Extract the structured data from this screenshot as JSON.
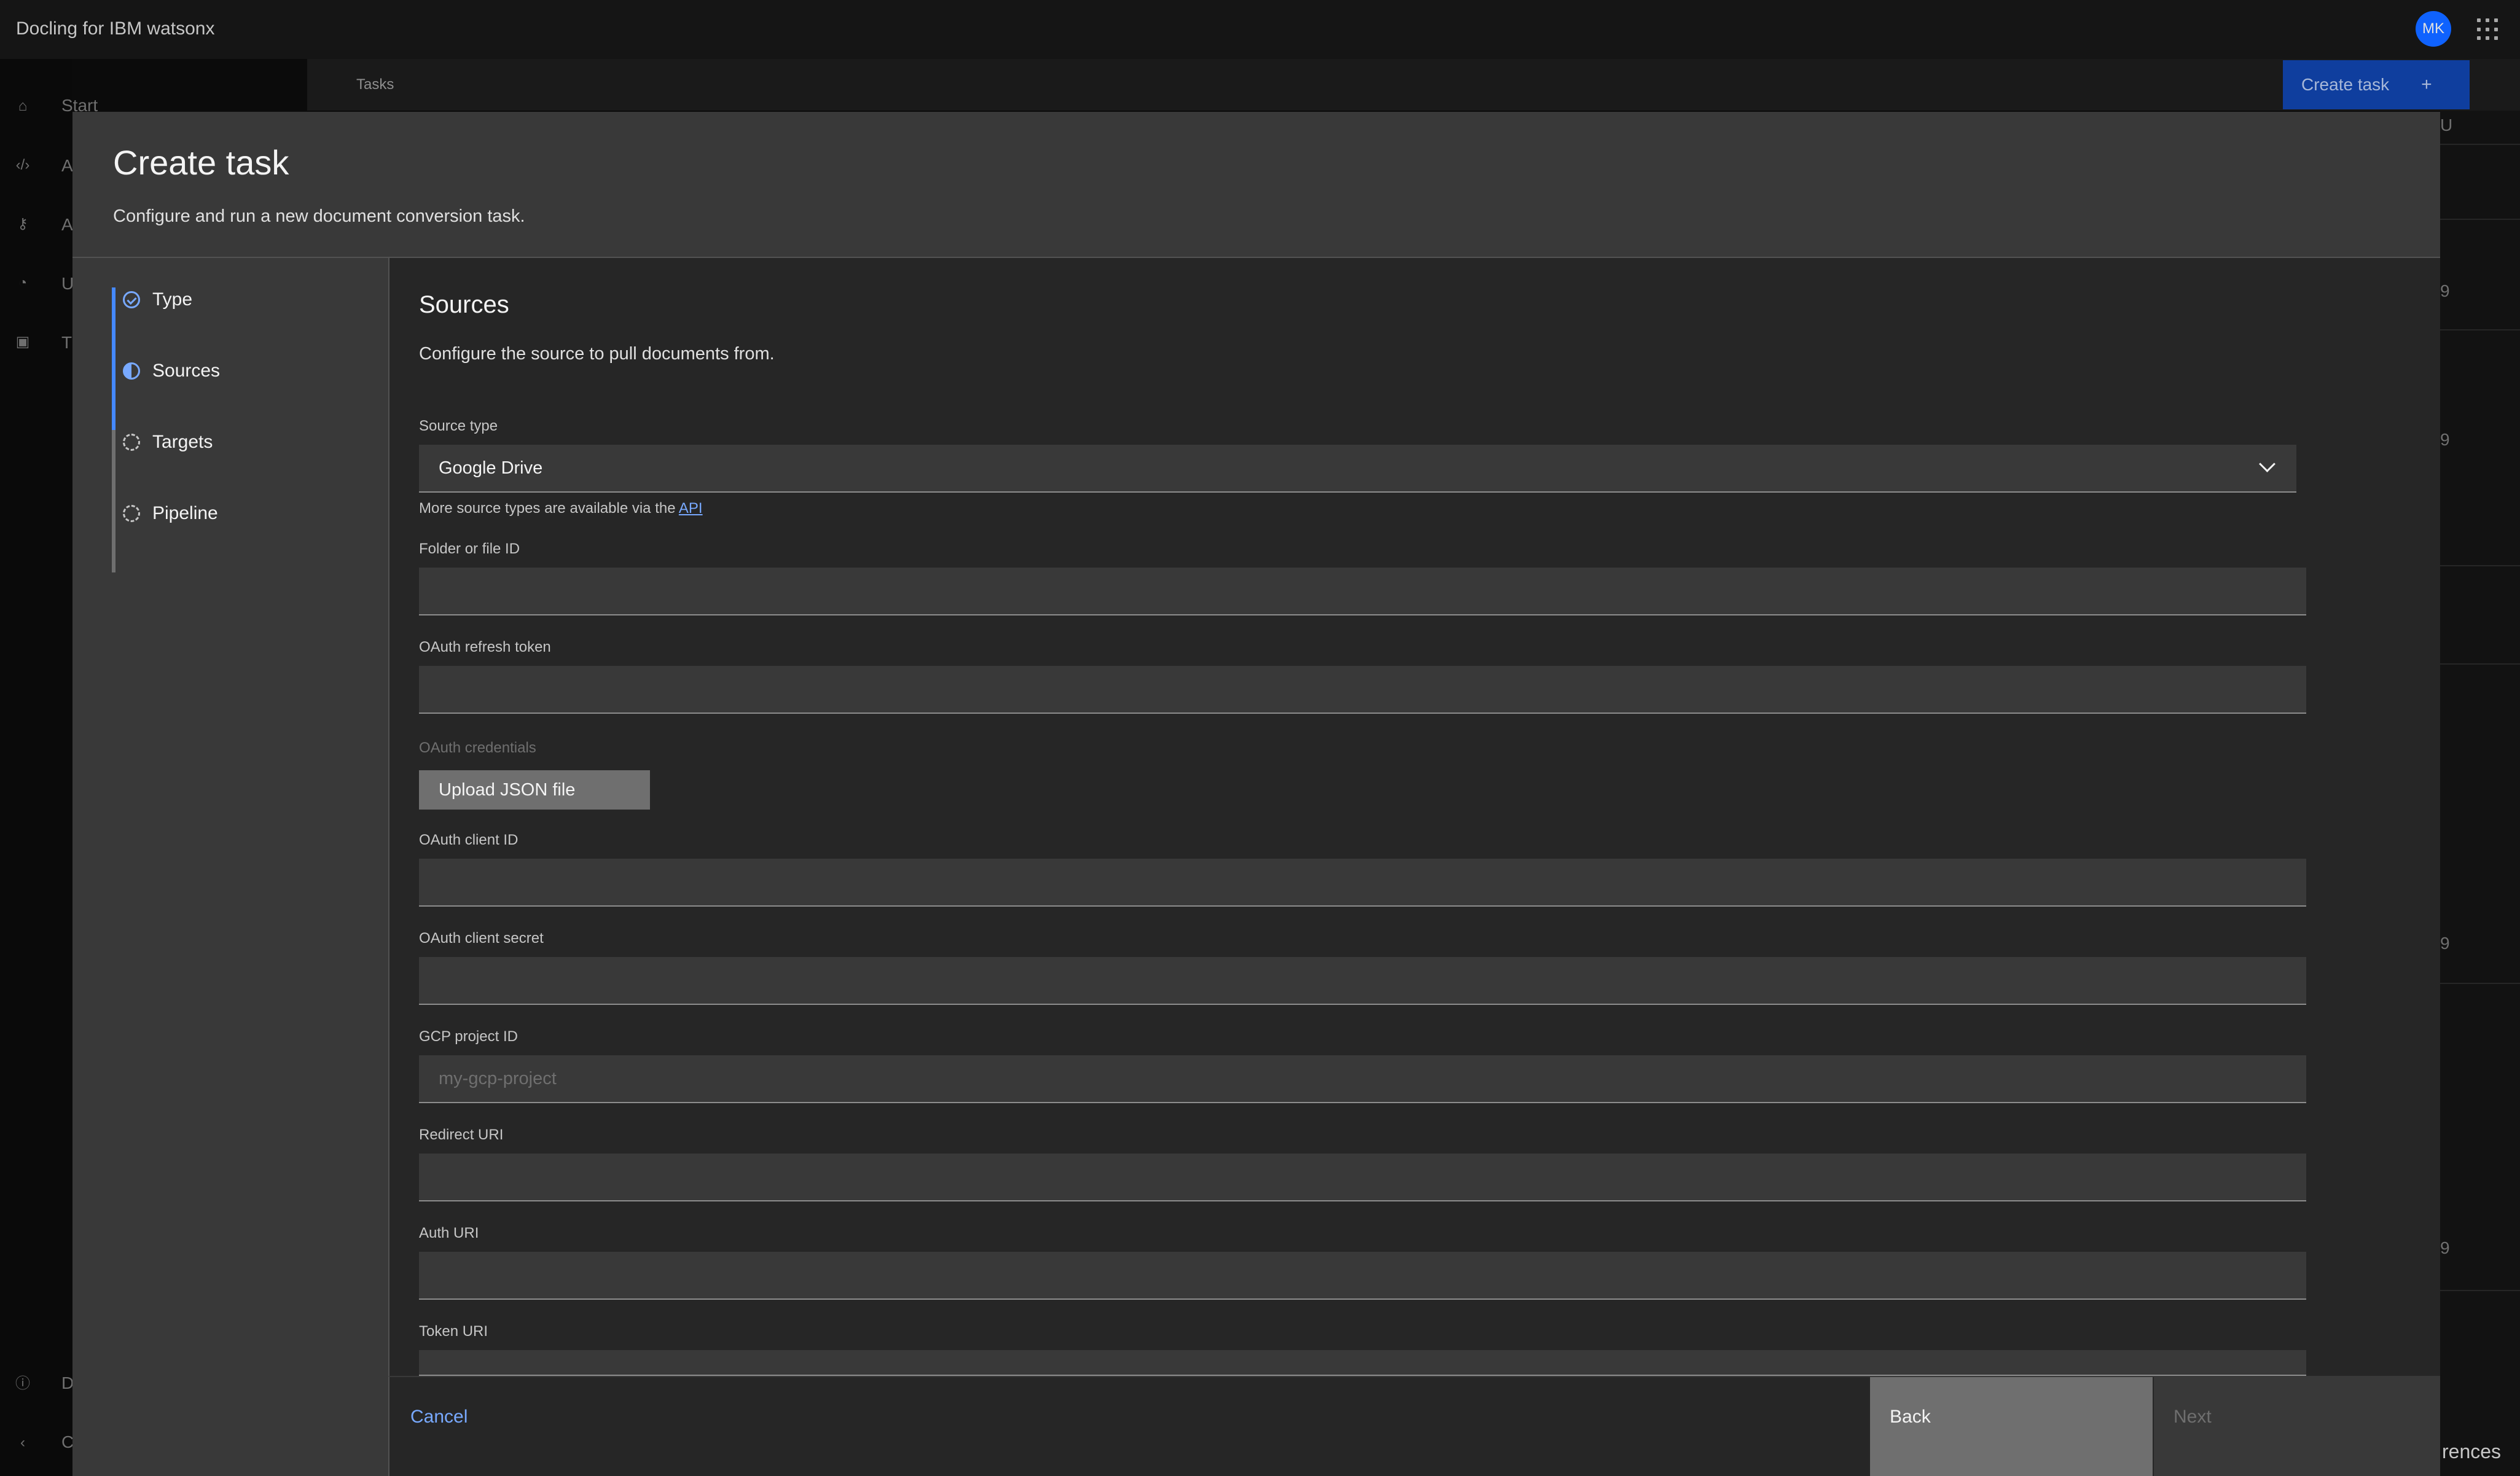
{
  "app": {
    "title": "Docling for IBM watsonx",
    "user_initials": "MK",
    "nav_letters": [
      "Start",
      "A",
      "A",
      "U",
      "T",
      "D",
      "C"
    ],
    "tasks_label": "Tasks",
    "create_task_button": "Create task",
    "create_task_plus": "+",
    "bg_right_digits": [
      "9",
      "9",
      "9",
      "9"
    ],
    "bg_bottom_text": "rences",
    "bg_top_letter": "U"
  },
  "modal": {
    "title": "Create task",
    "description": "Configure and run a new document conversion task.",
    "steps": [
      {
        "label": "Type",
        "status": "complete"
      },
      {
        "label": "Sources",
        "status": "current"
      },
      {
        "label": "Targets",
        "status": "incomplete"
      },
      {
        "label": "Pipeline",
        "status": "incomplete"
      }
    ],
    "section": {
      "title": "Sources",
      "description": "Configure the source to pull documents from."
    },
    "form": {
      "source_type": {
        "label": "Source type",
        "value": "Google Drive"
      },
      "helper_text": "More source types are available via the ",
      "helper_link": "API",
      "folder_id": {
        "label": "Folder or file ID",
        "value": ""
      },
      "oauth_refresh_token": {
        "label": "OAuth refresh token",
        "value": ""
      },
      "oauth_credentials": {
        "label": "OAuth credentials",
        "button": "Upload JSON file"
      },
      "oauth_client_id": {
        "label": "OAuth client ID",
        "value": ""
      },
      "oauth_client_secret": {
        "label": "OAuth client secret",
        "value": ""
      },
      "gcp_project_id": {
        "label": "GCP project ID",
        "placeholder": "my-gcp-project"
      },
      "redirect_uri": {
        "label": "Redirect URI",
        "value": ""
      },
      "auth_uri": {
        "label": "Auth URI",
        "value": ""
      },
      "token_uri": {
        "label": "Token URI",
        "value": ""
      }
    },
    "footer": {
      "cancel": "Cancel",
      "back": "Back",
      "next": "Next"
    }
  },
  "colors": {
    "accent": "#78a9ff",
    "primary_button": "#0f62fe",
    "modal_bg": "#393939",
    "content_bg": "#262626"
  }
}
